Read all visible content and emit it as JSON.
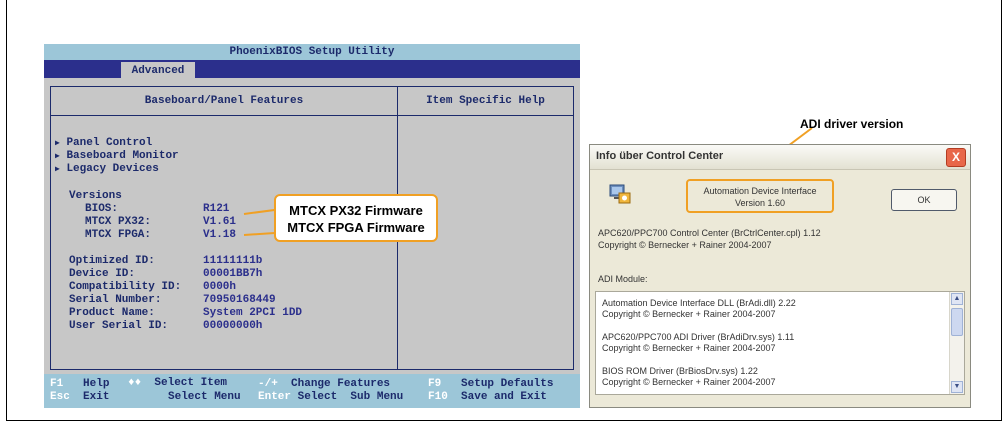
{
  "bios": {
    "title": "PhoenixBIOS Setup Utility",
    "tab": "Advanced",
    "section_title": "Baseboard/Panel Features",
    "help_title": "Item Specific Help",
    "menu_items": [
      "Panel Control",
      "Baseboard Monitor",
      "Legacy Devices"
    ],
    "versions_label": "Versions",
    "versions": [
      {
        "label": "BIOS:",
        "value": "R121"
      },
      {
        "label": "MTCX PX32:",
        "value": "V1.61"
      },
      {
        "label": "MTCX FPGA:",
        "value": "V1.18"
      }
    ],
    "info": [
      {
        "label": "Optimized ID:",
        "value": "11111111b"
      },
      {
        "label": "Device ID:",
        "value": "00001BB7h"
      },
      {
        "label": "Compatibility ID:",
        "value": "0000h"
      },
      {
        "label": "Serial Number:",
        "value": "70950168449"
      },
      {
        "label": "Product Name:",
        "value": "System 2PCI 1DD"
      },
      {
        "label": "User Serial ID:",
        "value": "00000000h"
      }
    ],
    "footer": {
      "f1": "F1",
      "help": "Help",
      "arrows": "♦♦",
      "select_item": "Select Item",
      "minus_plus": "-/+",
      "change_features": "Change Features",
      "f9": "F9",
      "setup_defaults": "Setup Defaults",
      "esc": "Esc",
      "exit": "Exit",
      "select_menu": "Select Menu",
      "enter": "Enter",
      "select_sub_menu": "Select  Sub Menu",
      "f10": "F10",
      "save_exit": "Save and Exit"
    }
  },
  "callout": {
    "line1": "MTCX PX32 Firmware",
    "line2": "MTCX FPGA Firmware"
  },
  "adi_label": "ADI driver version",
  "dialog": {
    "title": "Info über Control Center",
    "close": "X",
    "adi_name": "Automation Device Interface",
    "adi_version": "Version 1.60",
    "ok": "OK",
    "cc_line1": "APC620/PPC700 Control Center (BrCtrlCenter.cpl) 1.12",
    "cc_line2": "Copyright © Bernecker + Rainer 2004-2007",
    "modules_label": "ADI Module:",
    "modules": [
      {
        "name": "Automation Device Interface DLL (BrAdi.dll) 2.22",
        "copyright": "Copyright © Bernecker + Rainer 2004-2007"
      },
      {
        "name": "APC620/PPC700 ADI Driver (BrAdiDrv.sys) 1.11",
        "copyright": "Copyright © Bernecker + Rainer 2004-2007"
      },
      {
        "name": "BIOS ROM Driver (BrBiosDrv.sys) 1.22",
        "copyright": "Copyright © Bernecker + Rainer 2004-2007"
      }
    ]
  },
  "colors": {
    "bios_bg": "#c7c7c7",
    "bios_title_bg": "#9cc6d8",
    "bios_menubar": "#2b2f8c",
    "callout_border": "#f0a024"
  }
}
